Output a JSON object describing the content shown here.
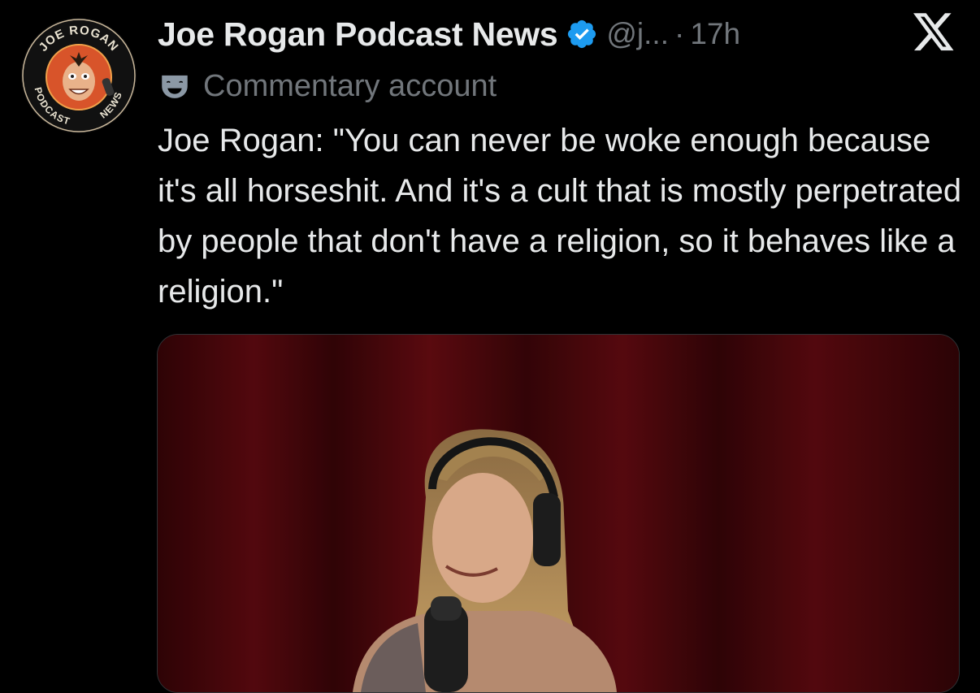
{
  "tweet": {
    "avatar": {
      "ring_text_top": "JOE ROGAN",
      "ring_text_left": "PODCAST",
      "ring_text_right": "NEWS"
    },
    "author_name": "Joe Rogan Podcast News",
    "handle": "@j...",
    "separator": "·",
    "timestamp": "17h",
    "label": "Commentary account",
    "text": "Joe Rogan: \"You can never be woke enough because it's all horseshit. And it's a cult that is mostly perpetrated by people that don't have a religion, so it behaves like a religion.\"",
    "verified_color": "#1d9bf0"
  },
  "icons": {
    "verified": "verified-badge-icon",
    "label": "commentary-mask-icon",
    "platform": "x-logo-icon"
  }
}
